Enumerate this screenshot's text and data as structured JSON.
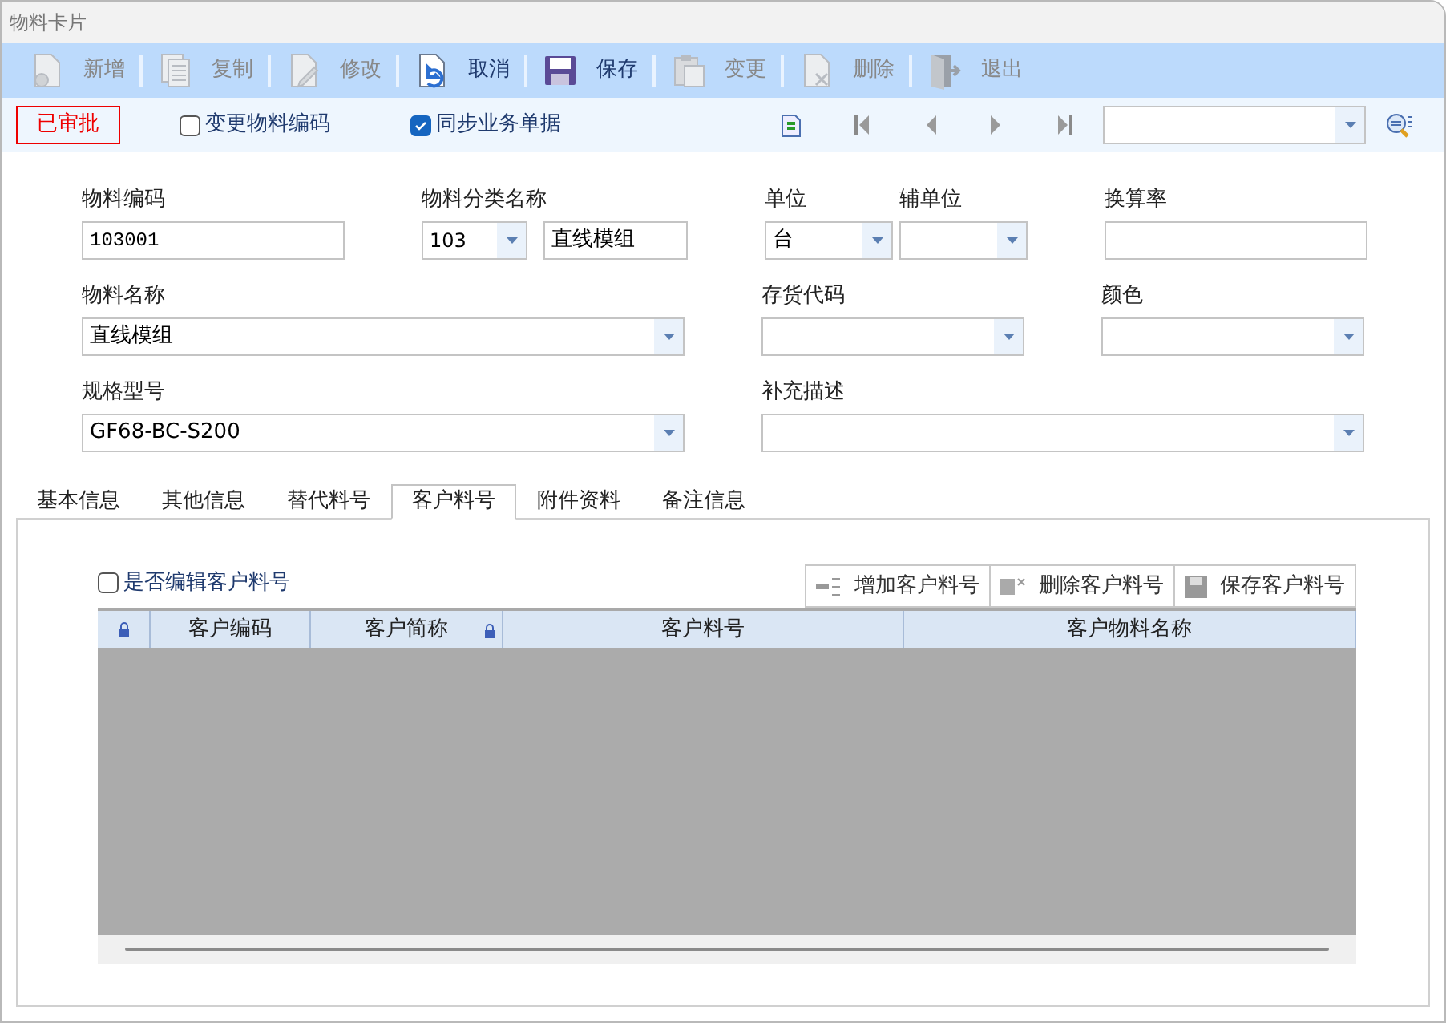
{
  "window": {
    "title": "物料卡片"
  },
  "toolbar": [
    {
      "label": "新增",
      "enabled": false
    },
    {
      "label": "复制",
      "enabled": false
    },
    {
      "label": "修改",
      "enabled": false
    },
    {
      "label": "取消",
      "enabled": true
    },
    {
      "label": "保存",
      "enabled": true
    },
    {
      "label": "变更",
      "enabled": false
    },
    {
      "label": "删除",
      "enabled": false
    },
    {
      "label": "退出",
      "enabled": false
    }
  ],
  "status_badge": "已审批",
  "options": [
    {
      "label": "变更物料编码",
      "checked": false
    },
    {
      "label": "同步业务单据",
      "checked": true
    }
  ],
  "form_rows": [
    [
      {
        "kind": "text",
        "label": "物料编码",
        "value": "103001"
      },
      {
        "kind": "code_select",
        "label": "物料分类名称",
        "code": "103",
        "value": "直线模组"
      },
      {
        "kind": "small_select",
        "label": "单位",
        "value": "台"
      },
      {
        "kind": "small_select",
        "label": "辅单位"
      },
      {
        "kind": "text",
        "label": "换算率"
      }
    ],
    [
      {
        "kind": "wide_select",
        "label": "物料名称",
        "value": "直线模组"
      },
      {
        "kind": "select",
        "label": "存货代码"
      },
      {
        "kind": "select",
        "label": "颜色"
      }
    ],
    [
      {
        "kind": "wide_select",
        "label": "规格型号",
        "value": "GF68-BC-S200"
      },
      {
        "kind": "wide_select",
        "label": "补充描述"
      }
    ]
  ],
  "tabs": [
    {
      "label": "基本信息",
      "selected": false
    },
    {
      "label": "其他信息",
      "selected": false
    },
    {
      "label": "替代料号",
      "selected": false
    },
    {
      "label": "客户料号",
      "selected": true
    },
    {
      "label": "附件资料",
      "selected": false
    },
    {
      "label": "备注信息",
      "selected": false
    }
  ],
  "customer_panel": {
    "edit_option": {
      "label": "是否编辑客户料号",
      "checked": false
    },
    "buttons": [
      {
        "label": "增加客户料号"
      },
      {
        "label": "删除客户料号"
      },
      {
        "label": "保存客户料号"
      }
    ],
    "table": {
      "columns": [
        {
          "locked": true
        },
        {
          "label": "客户编码",
          "locked": false
        },
        {
          "label": "客户简称",
          "locked": true
        },
        {
          "label": "客户料号",
          "locked": false
        },
        {
          "label": "客户物料名称",
          "locked": false
        }
      ]
    }
  }
}
